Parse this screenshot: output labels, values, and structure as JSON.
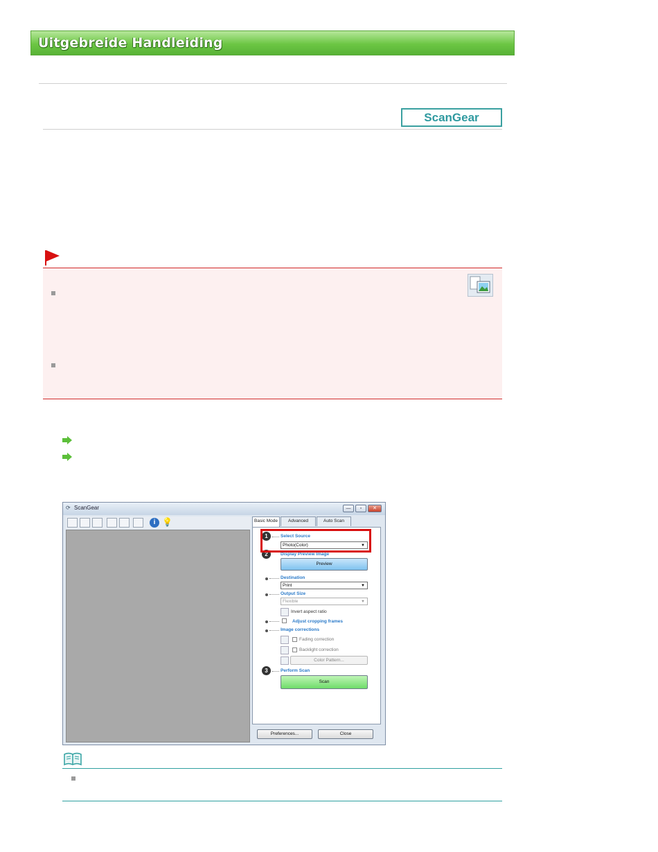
{
  "header": {
    "title": "Uitgebreide Handleiding"
  },
  "badge": {
    "label": "ScanGear"
  },
  "scangear_window": {
    "title": "ScanGear",
    "window_buttons": {
      "minimize": "—",
      "maximize": "▫",
      "close": "✕"
    },
    "tabs": [
      {
        "label": "Basic Mode"
      },
      {
        "label": "Advanced Mode"
      },
      {
        "label": "Auto Scan Mode"
      }
    ],
    "steps": {
      "step1": {
        "number": "1",
        "label": "Select Source",
        "value": "Photo(Color)"
      },
      "step2": {
        "number": "2",
        "label": "Display Preview Image",
        "button": "Preview"
      },
      "destination": {
        "label": "Destination",
        "value": "Print"
      },
      "output_size": {
        "label": "Output Size",
        "value": "Flexible"
      },
      "invert_aspect": "Invert aspect ratio",
      "adjust_cropping": "Adjust cropping frames",
      "image_corrections": {
        "label": "Image corrections",
        "fading": "Fading correction",
        "backlight": "Backlight correction",
        "color_pattern": "Color Pattern..."
      },
      "step3": {
        "number": "3",
        "label": "Perform Scan",
        "button": "Scan"
      }
    },
    "bottom_buttons": {
      "preferences": "Preferences...",
      "close": "Close"
    },
    "icons": [
      "photo-icon",
      "document-icon",
      "stack-icon",
      "multi-thumbnail-icon",
      "grid-view-icon",
      "list-view-icon",
      "info-icon",
      "lightbulb-icon"
    ]
  },
  "colors": {
    "banner_green": "#6cc644",
    "caution_red": "#d12a2a",
    "caution_bg": "#fdf0f0",
    "note_teal": "#2fa0a0",
    "link_arrow_green": "#5cbf3a"
  }
}
